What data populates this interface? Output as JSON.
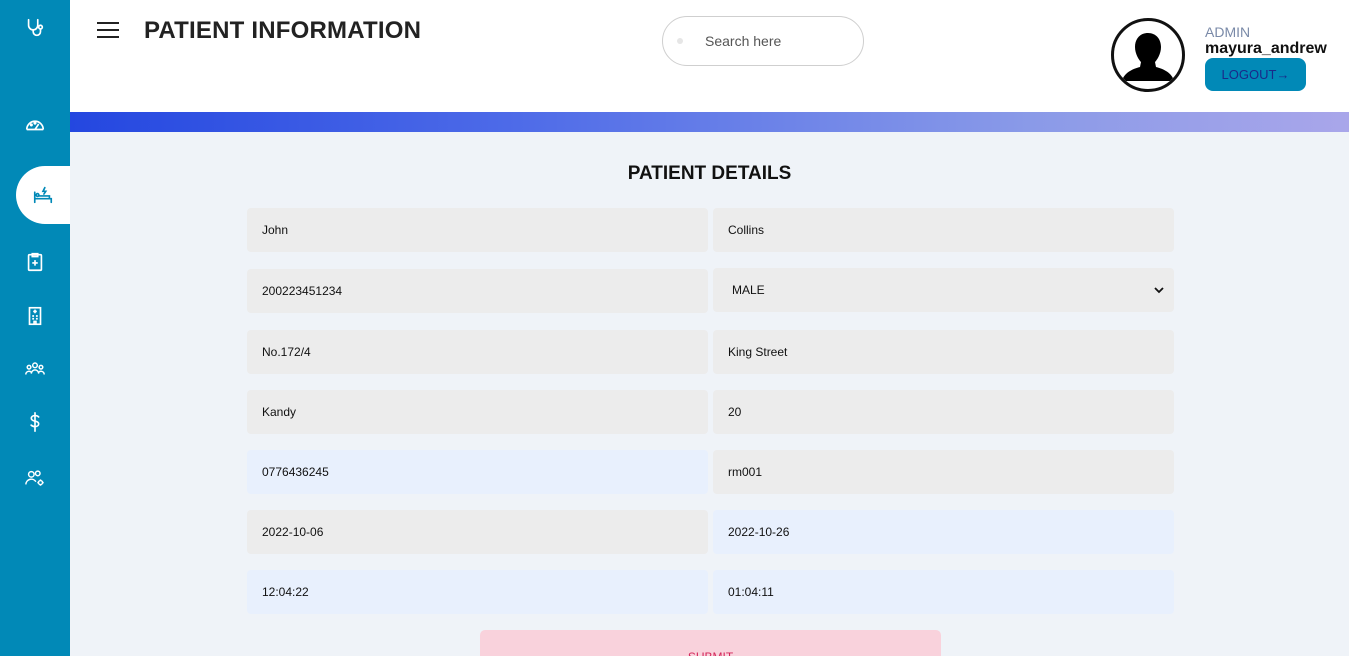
{
  "header": {
    "title": "PATIENT INFORMATION",
    "search_placeholder": "Search here",
    "role": "ADMIN",
    "username": "mayura_andrew",
    "logout_label": "LOGOUT→"
  },
  "sidebar": {
    "icons": [
      "stethoscope-icon",
      "dashboard-icon",
      "patient-bed-icon",
      "clipboard-plus-icon",
      "hospital-building-icon",
      "staff-group-icon",
      "dollar-icon",
      "user-settings-icon"
    ],
    "active": "patient-bed-icon"
  },
  "form": {
    "title": "PATIENT DETAILS",
    "first_name": "John",
    "last_name": "Collins",
    "nic": "200223451234",
    "gender": "MALE",
    "address_no": "No.172/4",
    "street": "King Street",
    "city": "Kandy",
    "age": "20",
    "phone": "0776436245",
    "room": "rm001",
    "admit_date": "2022-10-06",
    "discharge_date": "2022-10-26",
    "admit_time": "12:04:22",
    "discharge_time": "01:04:11",
    "submit_label": "SUBMIT"
  },
  "colors": {
    "sidebar": "#0189b7",
    "background": "#eff3f8",
    "submit_bg": "#f9d2dc",
    "submit_text": "#d3265a"
  }
}
